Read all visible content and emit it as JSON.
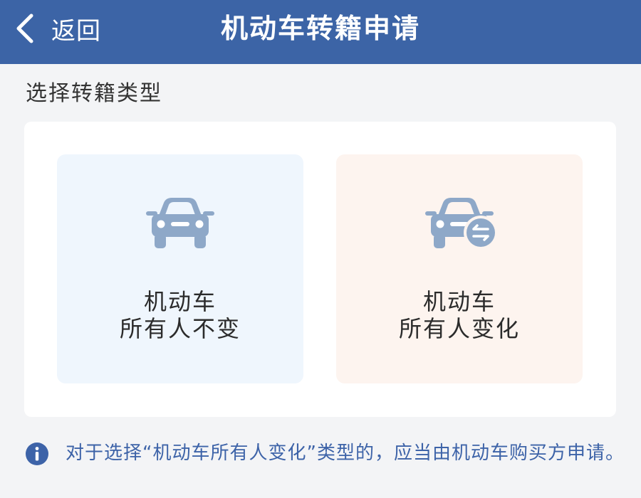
{
  "header": {
    "back_label": "返回",
    "title": "机动车转籍申请"
  },
  "section": {
    "label": "选择转籍类型"
  },
  "options": [
    {
      "line1": "机动车",
      "line2": "所有人不变",
      "icon": "car-icon"
    },
    {
      "line1": "机动车",
      "line2": "所有人变化",
      "icon": "car-transfer-icon"
    }
  ],
  "notice": {
    "text": "对于选择“机动车所有人变化”类型的，应当由机动车购买方申请。",
    "icon": "info-icon"
  },
  "colors": {
    "header_bg": "#3c64a6",
    "accent_text": "#3d63a8",
    "icon_gray_blue": "#8ea8c8",
    "option1_bg": "#eff6fd",
    "option2_bg": "#fdf4ef"
  }
}
